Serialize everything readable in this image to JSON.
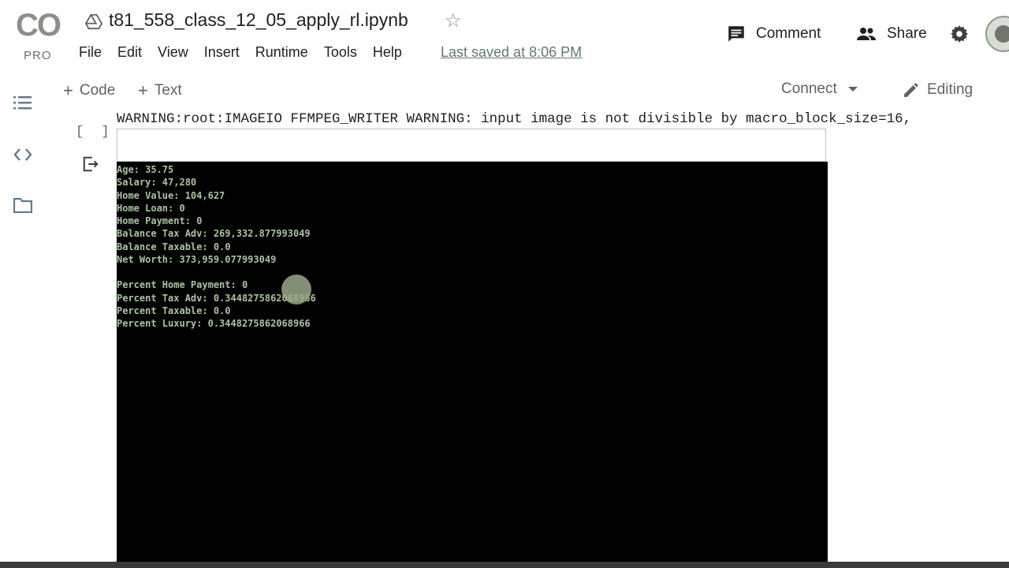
{
  "logo": {
    "text": "CO",
    "sub": "PRO"
  },
  "notebook": {
    "title": "t81_558_class_12_05_apply_rl.ipynb"
  },
  "menu": {
    "items": [
      {
        "label": "File"
      },
      {
        "label": "Edit"
      },
      {
        "label": "View"
      },
      {
        "label": "Insert"
      },
      {
        "label": "Runtime"
      },
      {
        "label": "Tools"
      },
      {
        "label": "Help"
      }
    ],
    "last_saved": "Last saved at 8:06 PM"
  },
  "header": {
    "comment_label": "Comment",
    "share_label": "Share"
  },
  "toolbar": {
    "code_label": "Code",
    "text_label": "Text",
    "connect_label": "Connect",
    "editing_label": "Editing"
  },
  "cell": {
    "bracket": "[ ]",
    "warning": "WARNING:root:IMAGEIO FFMPEG_WRITER WARNING: input image is not divisible by macro_block_size=16,",
    "output_lines": [
      "Age: 35.75",
      "Salary: 47,280",
      "Home Value: 104,627",
      "Home Loan: 0",
      "Home Payment: 0",
      "Balance Tax Adv: 269,332.877993049",
      "Balance Taxable: 0.0",
      "Net Worth: 373,959.077993049"
    ],
    "output_lines_2": [
      "Percent Home Payment: 0",
      "Percent Tax Adv: 0.3448275862068966",
      "Percent Taxable: 0.0",
      "Percent Luxury: 0.3448275862068966"
    ]
  },
  "colors": {
    "terminal_text": "#a8c4a0",
    "terminal_bg": "#000000",
    "accent": "#5f7a6a"
  },
  "icons": [
    "drive-icon",
    "star-icon",
    "comment-icon",
    "share-people-icon",
    "gear-icon",
    "toc-icon",
    "code-snippets-icon",
    "folder-icon",
    "output-icon",
    "pencil-icon"
  ]
}
